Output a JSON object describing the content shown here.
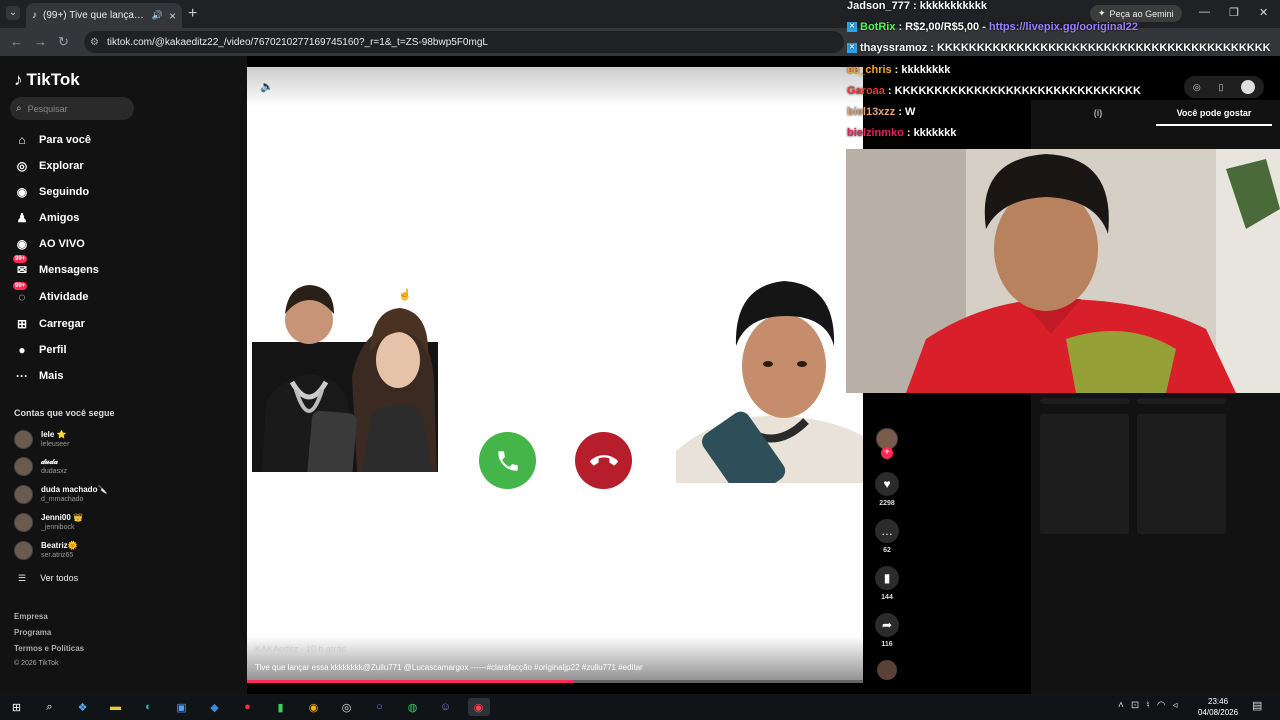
{
  "browser": {
    "tab_title": "(99+) Tive que lançar essa k...",
    "url": "tiktok.com/@kakaeditz22_/video/7670210277169745160?_r=1&_t=ZS-98bwp5F0mgL",
    "gemini_label": "Peça ao Gemini"
  },
  "sidebar": {
    "logo": "TikTok",
    "search_placeholder": "Pesquisar",
    "nav": [
      {
        "label": "Para você",
        "icon": "compass-icon"
      },
      {
        "label": "Explorar",
        "icon": "explore-icon"
      },
      {
        "label": "Seguindo",
        "icon": "following-icon"
      },
      {
        "label": "Amigos",
        "icon": "friends-icon"
      },
      {
        "label": "AO VIVO",
        "icon": "live-icon"
      },
      {
        "label": "Mensagens",
        "icon": "messages-icon",
        "badge": "99+"
      },
      {
        "label": "Atividade",
        "icon": "activity-icon",
        "badge": "99+"
      },
      {
        "label": "Carregar",
        "icon": "upload-icon"
      },
      {
        "label": "Perfil",
        "icon": "profile-icon"
      },
      {
        "label": "Mais",
        "icon": "more-icon"
      }
    ],
    "following_title": "Contas que você segue",
    "accounts": [
      {
        "name": "lele ⭐",
        "handle": "leleuseer"
      },
      {
        "name": "𝒹𝓊𝒹𝒶",
        "handle": "dudasxz"
      },
      {
        "name": "duda machado🔪",
        "handle": "d_mmachado"
      },
      {
        "name": "Jenni00 👑",
        "handle": "_jennibock"
      },
      {
        "name": "Beatriz🌞",
        "handle": "ser.atriz65"
      }
    ],
    "see_all": "Ver todos",
    "footer": [
      "Empresa",
      "Programa",
      "Termos e Políticas",
      "© 2026 TikTok"
    ]
  },
  "video": {
    "author": "KAKAeditz · 10 h atrás",
    "caption": "Tive que lançar essa kkkkkkkk@Zullu771 @Lucascamargox ------#clarafacção #originaljp22 #zullu771 #editar",
    "progress": 0.53
  },
  "actions": [
    {
      "name": "like",
      "count": "2298",
      "glyph": "♥"
    },
    {
      "name": "comment",
      "count": "62",
      "glyph": "…"
    },
    {
      "name": "save",
      "count": "144",
      "glyph": "▮"
    },
    {
      "name": "share",
      "count": "116",
      "glyph": "➦"
    }
  ],
  "right_panel": {
    "tabs": [
      "(i)",
      "Você pode gostar"
    ]
  },
  "chat": [
    {
      "user": "Jadson_777",
      "color": "#ffffff",
      "text": ": kkkkkkkkkkk"
    },
    {
      "user": "BotRix",
      "color": "#59f25e",
      "text": ": R$2,00/R$5,00 - ",
      "link": "https://livepix.gg/ooriginal22"
    },
    {
      "user": "thayssramoz",
      "color": "#ffffff",
      "text": ": KKKKKKKKKKKKKKKKKKKKKKKKKKKKKKKKKKKKKKKKKK"
    },
    {
      "user": "ee_chris",
      "color": "#f5a623",
      "text": ": kkkkkkkk"
    },
    {
      "user": "Garoaa",
      "color": "#e53935",
      "text": ": KKKKKKKKKKKKKKKKKKKKKKKKKKKKKKK"
    },
    {
      "user": "biel13xzz",
      "color": "#e0a070",
      "text": ": W"
    },
    {
      "user": "bielzinmko",
      "color": "#e0245e",
      "text": ": kkkkkkk"
    }
  ],
  "taskbar": {
    "time": "23:46",
    "date": "04/08/2026"
  }
}
